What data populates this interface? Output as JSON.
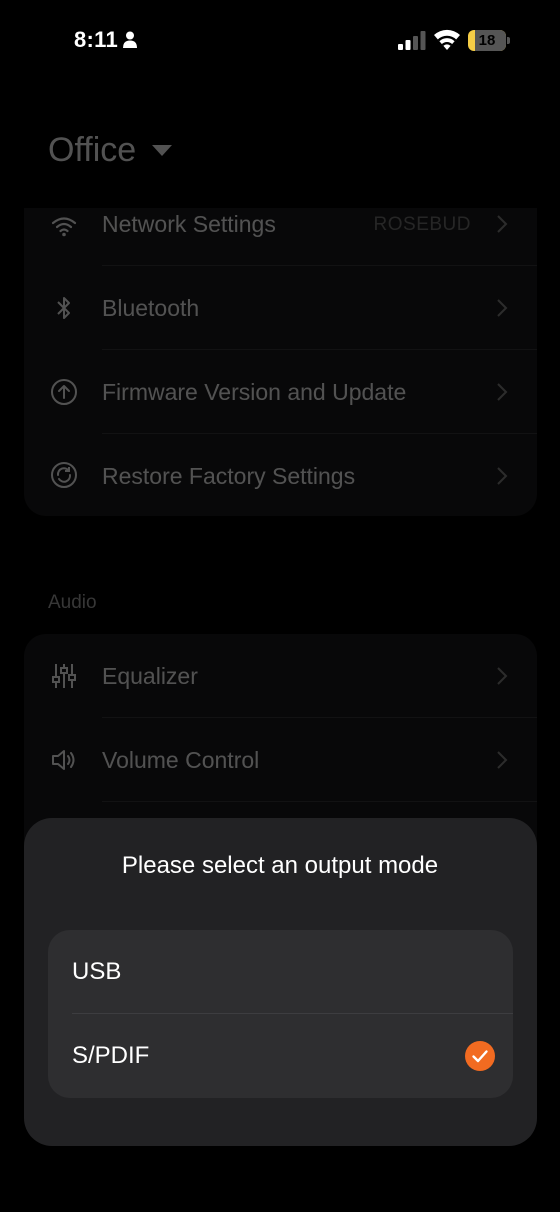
{
  "status_bar": {
    "time": "8:11",
    "battery_level": "18",
    "battery_fraction": 0.18,
    "icons": [
      "person-icon",
      "signal-icon",
      "wifi-icon",
      "battery-icon"
    ]
  },
  "page": {
    "title": "Office",
    "device_settings": [
      {
        "label": "Network Settings",
        "value": "ROSEBUD",
        "icon": "wifi-icon"
      },
      {
        "label": "Bluetooth",
        "value": "",
        "icon": "bluetooth-icon"
      },
      {
        "label": "Firmware Version and Update",
        "value": "",
        "icon": "update-icon"
      },
      {
        "label": "Restore Factory Settings",
        "value": "",
        "icon": "restore-icon"
      }
    ],
    "audio_section_label": "Audio",
    "audio_settings": [
      {
        "label": "Equalizer",
        "icon": "equalizer-icon"
      },
      {
        "label": "Volume Control",
        "icon": "speaker-icon"
      }
    ]
  },
  "sheet": {
    "title": "Please select an output mode",
    "options": [
      {
        "label": "USB",
        "selected": false
      },
      {
        "label": "S/PDIF",
        "selected": true
      }
    ],
    "accent_color": "#f26b21"
  }
}
